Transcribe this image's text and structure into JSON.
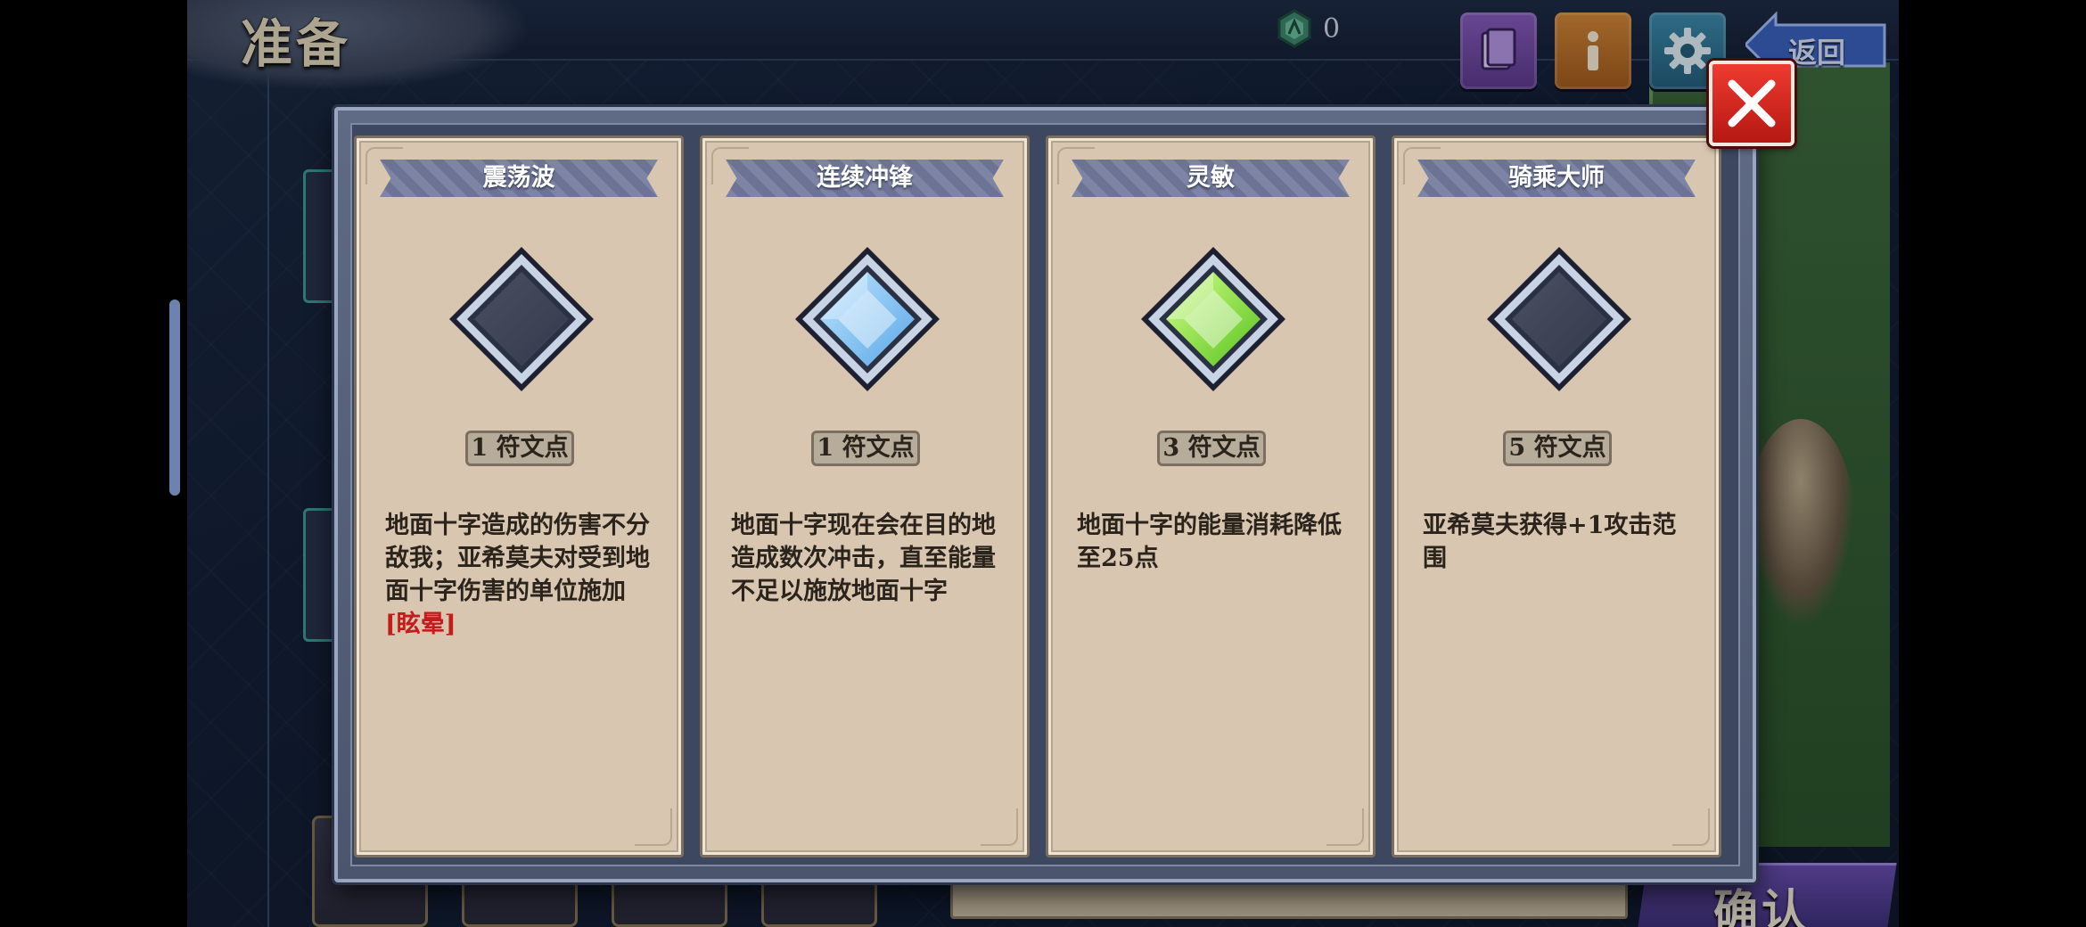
{
  "header": {
    "title": "准备"
  },
  "currency": {
    "icon": "green-gem-icon",
    "value": "0"
  },
  "toolbar": {
    "book_icon": "book-icon",
    "info_icon": "info-icon",
    "settings_icon": "gear-icon",
    "back_label": "返回"
  },
  "confirm": {
    "label": "确认"
  },
  "modal": {
    "close_icon": "close-icon",
    "cards": [
      {
        "title": "震荡波",
        "gem": "empty",
        "cost": "1 符文点",
        "desc_parts": [
          "地面十字造成的伤害不分敌我；亚希莫夫对受到地面十字伤害的单位施加",
          "[眩晕]"
        ]
      },
      {
        "title": "连续冲锋",
        "gem": "blue",
        "cost": "1 符文点",
        "desc_parts": [
          "地面十字现在会在目的地造成数次冲击，直至能量不足以施放地面十字",
          ""
        ]
      },
      {
        "title": "灵敏",
        "gem": "green",
        "cost": "3 符文点",
        "desc_parts": [
          "地面十字的能量消耗降低至25点",
          ""
        ]
      },
      {
        "title": "骑乘大师",
        "gem": "empty",
        "cost": "5 符文点",
        "desc_parts": [
          "亚希莫夫获得+1攻击范围",
          ""
        ]
      }
    ]
  },
  "colors": {
    "gem_blue": "#7fc3f5",
    "gem_green": "#7ce23a",
    "gem_empty": "#3b4152",
    "highlight_red": "#c41b1b"
  }
}
